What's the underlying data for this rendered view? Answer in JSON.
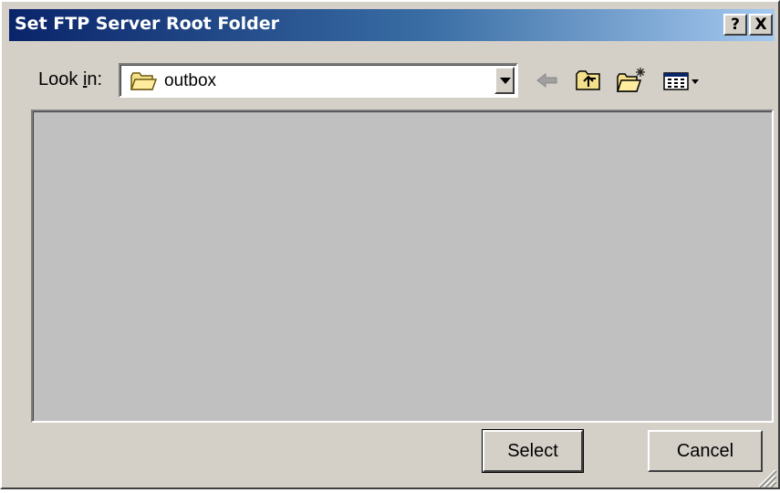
{
  "window": {
    "title": "Set FTP Server Root Folder",
    "help_label": "?",
    "close_label": "X"
  },
  "lookin": {
    "label_prefix": "Look ",
    "label_accel": "i",
    "label_suffix": "n:",
    "value": "outbox",
    "icon": "folder-icon"
  },
  "toolbar": {
    "icons": [
      "back-arrow-icon",
      "up-one-level-icon",
      "new-folder-icon",
      "view-menu-icon"
    ]
  },
  "buttons": {
    "select": "Select",
    "cancel": "Cancel"
  },
  "colors": {
    "title_gradient_start": "#0a246a",
    "title_gradient_end": "#a6caf0",
    "dialog_face": "#d4d0c8",
    "list_background": "#c0c0c0"
  }
}
